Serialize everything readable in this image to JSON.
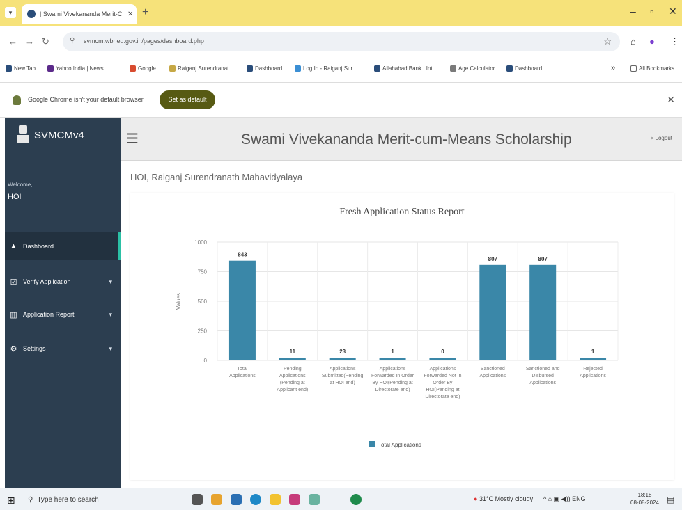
{
  "browser": {
    "tab_title": "| Swami Vivekananda Merit-C...",
    "tab_close": "✕",
    "new_tab": "+",
    "url": "svmcm.wbhed.gov.in/pages/dashboard.php",
    "window_min": "–",
    "window_max": "▫",
    "window_close": "✕"
  },
  "bookmarks": [
    {
      "label": "New Tab",
      "color": "#2a4d7a"
    },
    {
      "label": "Yahoo India | News...",
      "color": "#5b2a8a"
    },
    {
      "label": "Google",
      "color": "#d84b2f"
    },
    {
      "label": "Raiganj Surendranat...",
      "color": "#c6a845"
    },
    {
      "label": "Dashboard",
      "color": "#2a4d7a"
    },
    {
      "label": "Log In - Raiganj Sur...",
      "color": "#3b8fd4"
    },
    {
      "label": "Allahabad Bank : Int...",
      "color": "#2a4d7a"
    },
    {
      "label": "Age Calculator",
      "color": "#7a7a7a"
    },
    {
      "label": "Dashboard",
      "color": "#2a4d7a"
    }
  ],
  "bookmarks_more": "»",
  "all_bookmarks": "All Bookmarks",
  "infobar": {
    "text": "Google Chrome isn't your default browser",
    "button": "Set as default",
    "close": "✕"
  },
  "sidebar": {
    "brand": "SVMCMv4",
    "welcome": "Welcome,",
    "user": "HOI",
    "items": [
      {
        "label": "Dashboard",
        "icon": "▲",
        "caret": ""
      },
      {
        "label": "Verify Application",
        "icon": "☑",
        "caret": "▾"
      },
      {
        "label": "Application Report",
        "icon": "▥",
        "caret": "▾"
      },
      {
        "label": "Settings",
        "icon": "⚙",
        "caret": "▾"
      }
    ]
  },
  "header": {
    "hamburger": "☰",
    "title": "Swami Vivekananda Merit-cum-Means Scholarship",
    "logout": "Logout"
  },
  "college": "HOI, Raiganj Surendranath Mahavidyalaya",
  "chart_data": {
    "type": "bar",
    "title": "Fresh Application Status Report",
    "ylabel": "Values",
    "ylim": [
      0,
      1000
    ],
    "yticks": [
      0,
      250,
      500,
      750,
      1000
    ],
    "categories": [
      [
        "Total",
        "Applications"
      ],
      [
        "Pending",
        "Applications",
        "(Pending at",
        "Applicant end)"
      ],
      [
        "Applications",
        "Submitted(Pending",
        "at HOI end)"
      ],
      [
        "Applications",
        "Forwarded In Order",
        "By HOI(Pending at",
        "Directorate end)"
      ],
      [
        "Applications",
        "Forwarded Not In",
        "Order By",
        "HOI(Pending at",
        "Directorate end)"
      ],
      [
        "Sanctioned",
        "Applications"
      ],
      [
        "Sanctioned and",
        "Disbursed",
        "Applications"
      ],
      [
        "Rejected",
        "Applications"
      ]
    ],
    "series": [
      {
        "name": "Total Applications",
        "values": [
          843,
          11,
          23,
          1,
          0,
          807,
          807,
          1
        ],
        "color": "#3a87a8"
      }
    ],
    "grid": true,
    "legend": "bottom"
  },
  "taskbar": {
    "search_placeholder": "Type here to search",
    "weather": "31°C  Mostly cloudy",
    "lang": "ENG",
    "time": "18:18",
    "date": "08-08-2024"
  }
}
